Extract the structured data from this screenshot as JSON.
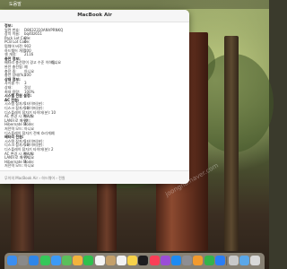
{
  "menubar": {
    "app_name": "도움말"
  },
  "window": {
    "title": "MacBook Air",
    "status_path": "무이의 MacBook Air › 하드웨어 › 전원"
  },
  "report_rows": [
    {
      "key": "정보:",
      "value": "",
      "section": true
    },
    {
      "key": "일련 번호:",
      "value": "D8632310ANVPRNKQ",
      "section": false
    },
    {
      "key": "장치 이름:",
      "value": "bq40z651",
      "section": false
    },
    {
      "key": "Pack Lot Code:",
      "value": "0",
      "section": false
    },
    {
      "key": "PCB Lot Code:",
      "value": "0",
      "section": false
    },
    {
      "key": "펌웨어 버전:",
      "value": "902",
      "section": false
    },
    {
      "key": "하드웨어 개정:",
      "value": "100",
      "section": false
    },
    {
      "key": "셀 개정:",
      "value": "2116",
      "section": false
    },
    {
      "key": "충전 정보:",
      "value": "",
      "section": true
    },
    {
      "key": "배터리 충전량이 경고 수준 이하임:",
      "value": "아니요",
      "section": false
    },
    {
      "key": "완전 충전됨:",
      "value": "예",
      "section": false
    },
    {
      "key": "충전 중:",
      "value": "아니요",
      "section": false
    },
    {
      "key": "충전 상태(%):",
      "value": "100",
      "section": false
    },
    {
      "key": "상태 정보:",
      "value": "",
      "section": true
    },
    {
      "key": "사이클 수:",
      "value": "3",
      "section": false
    },
    {
      "key": "상태:",
      "value": "정상",
      "section": false
    },
    {
      "key": "최대 용량:",
      "value": "100%",
      "section": false
    },
    {
      "key": "시스템 전원 설정:",
      "value": "",
      "section": true
    },
    {
      "key": "AC 전원:",
      "value": "",
      "section": true
    },
    {
      "key": "시스템 잠자기 타이머(분):",
      "value": "1",
      "section": false
    },
    {
      "key": "디스크 잠자기 타이머(분):",
      "value": "10",
      "section": false
    },
    {
      "key": "디스플레이 잠자기 타이머(분):",
      "value": "10",
      "section": false
    },
    {
      "key": "AC 변경 시 깨우기:",
      "value": "아니요",
      "section": false
    },
    {
      "key": "LAN으로 깨우기:",
      "value": "예",
      "section": false
    },
    {
      "key": "Hibernate Mode:",
      "value": "3",
      "section": false
    },
    {
      "key": "저전력 모드:",
      "value": "아니요",
      "section": false
    },
    {
      "key": "디스플레이 잠자기 전에 흐리게:",
      "value": "예",
      "section": false
    },
    {
      "key": "배터리 전원:",
      "value": "",
      "section": true
    },
    {
      "key": "시스템 잠자기 타이머(분):",
      "value": "1",
      "section": false
    },
    {
      "key": "디스크 잠자기 타이머(분):",
      "value": "10",
      "section": false
    },
    {
      "key": "디스플레이 잠자기 타이머(분):",
      "value": "2",
      "section": false
    },
    {
      "key": "AC 변경 시 깨우기:",
      "value": "아니요",
      "section": false
    },
    {
      "key": "LAN으로 깨우기:",
      "value": "아니요",
      "section": false
    },
    {
      "key": "Hibernate Mode:",
      "value": "3",
      "section": false
    },
    {
      "key": "저전력 모드:",
      "value": "아니요",
      "section": false
    }
  ],
  "watermark": {
    "text": "joongna.naver.com"
  },
  "dock": {
    "items": [
      {
        "name": "finder-icon",
        "color": "#3b8ef0"
      },
      {
        "name": "launchpad-icon",
        "color": "#8a8a8a"
      },
      {
        "name": "safari-icon",
        "color": "#2f86e8"
      },
      {
        "name": "messages-icon",
        "color": "#35c759"
      },
      {
        "name": "mail-icon",
        "color": "#3d9af5"
      },
      {
        "name": "maps-icon",
        "color": "#5bbf5a"
      },
      {
        "name": "photos-icon",
        "color": "#f2b33d"
      },
      {
        "name": "facetime-icon",
        "color": "#2fc04e"
      },
      {
        "name": "calendar-icon",
        "color": "#f4f4f4"
      },
      {
        "name": "contacts-icon",
        "color": "#c4a06a"
      },
      {
        "name": "reminders-icon",
        "color": "#f2f2f2"
      },
      {
        "name": "notes-icon",
        "color": "#f7d24a"
      },
      {
        "name": "tv-icon",
        "color": "#1c1c1e"
      },
      {
        "name": "music-icon",
        "color": "#fa3e57"
      },
      {
        "name": "podcasts-icon",
        "color": "#9b4dd6"
      },
      {
        "name": "app-store-icon",
        "color": "#1e8bf2"
      },
      {
        "name": "system-settings-icon",
        "color": "#8e8e93"
      },
      {
        "name": "pages-icon",
        "color": "#f29a2e"
      },
      {
        "name": "numbers-icon",
        "color": "#34b34a"
      },
      {
        "name": "keynote-icon",
        "color": "#2b7ef5"
      },
      {
        "name": "system-information-icon",
        "color": "#c9c9c9"
      },
      {
        "name": "downloads-icon",
        "color": "#5aa7e8"
      },
      {
        "name": "trash-icon",
        "color": "#d9d9d9"
      }
    ]
  }
}
